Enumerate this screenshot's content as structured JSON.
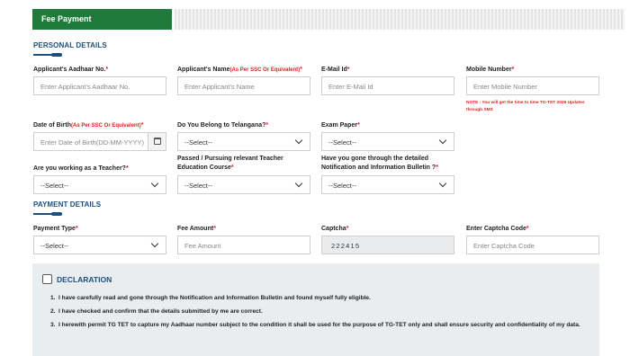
{
  "tab": {
    "label": "Fee Payment"
  },
  "personal": {
    "section_title": "PERSONAL DETAILS",
    "aadhaar": {
      "label": "Applicant's Aadhaar No.",
      "req": "*",
      "placeholder": "Enter Applicant's Aadhaar No."
    },
    "name": {
      "label": "Applicant's Name",
      "note": "(As Per SSC Or Equivalent)",
      "req": "*",
      "placeholder": "Enter Applicant's Name"
    },
    "email": {
      "label": "E-Mail Id",
      "req": "*",
      "placeholder": "Enter E-Mail Id"
    },
    "mobile": {
      "label": "Mobile Number",
      "req": "*",
      "placeholder": "Enter Mobile Number",
      "note": "NOTE : You will get the time to time TG-TET 2026 Updates through SMS"
    },
    "dob": {
      "label": "Date of Birth",
      "note": "(As Per SSC Or Equivalent)",
      "req": "*",
      "placeholder": "Enter Date of Birth(DD-MM-YYYY)"
    },
    "telangana": {
      "label": "Do You Belong to Telangana?",
      "req": "*",
      "value": "--Select--"
    },
    "exam_paper": {
      "label": "Exam Paper",
      "req": "*",
      "value": "--Select--"
    },
    "teacher": {
      "label": "Are you working as a Teacher?",
      "req": "*",
      "value": "--Select--"
    },
    "course": {
      "label_line1": "Passed / Pursuing relevant Teacher",
      "label_line2": "Education Course",
      "req": "*",
      "value": "--Select--"
    },
    "bulletin": {
      "label_line1": "Have you gone through the detailed",
      "label_line2": "Notification and Information Bulletin ?",
      "req": "*",
      "value": "--Select--"
    }
  },
  "payment": {
    "section_title": "PAYMENT DETAILS",
    "type": {
      "label": "Payment Type",
      "req": "*",
      "value": "--Select--"
    },
    "fee": {
      "label": "Fee Amount",
      "req": "*",
      "placeholder": "Fee Amount"
    },
    "captcha": {
      "label": "Captcha",
      "req": "*",
      "value": "222415"
    },
    "captcha_code": {
      "label": "Enter Captcha Code",
      "req": "*",
      "placeholder": "Enter Captcha Code"
    }
  },
  "declaration": {
    "title": "DECLARATION",
    "items": [
      {
        "num": "1.",
        "text": "I have carefully read and gone through the Notification and Information Bulletin and found myself fully eligible."
      },
      {
        "num": "2.",
        "text": "I have checked and confirm that the details submitted by me are correct."
      },
      {
        "num": "3.",
        "text": "I herewith permit TG TET to capture my Aadhaar number subject to the condition it shall be used for the purpose of TG-TET only and shall ensure security and confidentiality of my data."
      }
    ]
  },
  "colors": {
    "tab_green": "#1f7a3c",
    "heading_blue": "#1d4f7c",
    "required_red": "#e02020",
    "declaration_bg": "#e9edf0"
  }
}
